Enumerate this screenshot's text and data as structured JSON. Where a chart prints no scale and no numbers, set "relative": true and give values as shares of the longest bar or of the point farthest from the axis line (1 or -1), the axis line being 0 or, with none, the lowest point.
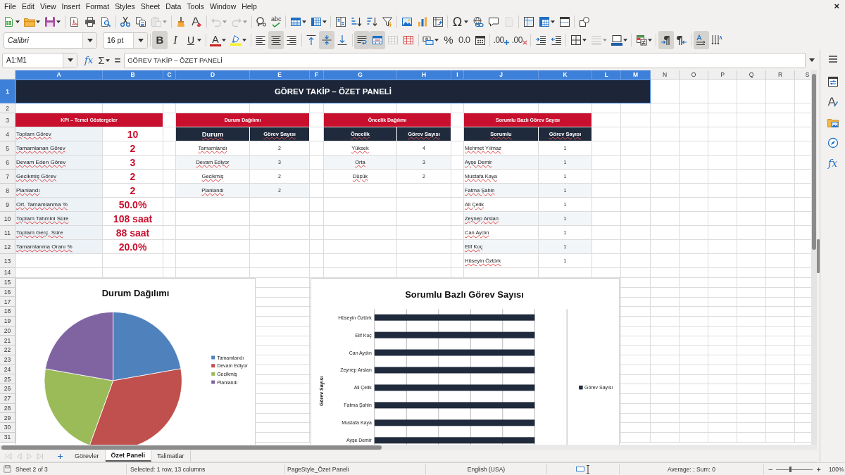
{
  "menu_bar": {
    "items": [
      "File",
      "Edit",
      "View",
      "Insert",
      "Format",
      "Styles",
      "Sheet",
      "Data",
      "Tools",
      "Window",
      "Help"
    ],
    "close": "×"
  },
  "standard_toolbar": {
    "groups": [
      [
        {
          "kind": "new",
          "dropdown": true,
          "disabled": false
        },
        {
          "kind": "open",
          "dropdown": true,
          "disabled": false
        },
        {
          "kind": "save",
          "dropdown": true,
          "disabled": false
        }
      ],
      [
        {
          "kind": "export_pdf",
          "dropdown": false,
          "disabled": false
        },
        {
          "kind": "print",
          "dropdown": false,
          "disabled": false
        },
        {
          "kind": "print_preview",
          "dropdown": false,
          "disabled": false
        }
      ],
      [
        {
          "kind": "cut",
          "dropdown": false,
          "disabled": false
        },
        {
          "kind": "copy",
          "dropdown": false,
          "disabled": false
        },
        {
          "kind": "paste",
          "dropdown": true,
          "disabled": true
        }
      ],
      [
        {
          "kind": "clone_formatting",
          "dropdown": false,
          "disabled": false
        },
        {
          "kind": "clear_formatting",
          "dropdown": false,
          "disabled": false
        }
      ],
      [
        {
          "kind": "undo",
          "dropdown": true,
          "disabled": true
        },
        {
          "kind": "redo",
          "dropdown": true,
          "disabled": true
        }
      ],
      [
        {
          "kind": "find_replace",
          "dropdown": false,
          "disabled": false
        },
        {
          "kind": "spelling",
          "label": "abc",
          "dropdown": false,
          "disabled": false
        }
      ],
      [
        {
          "kind": "rows",
          "dropdown": true,
          "disabled": false
        },
        {
          "kind": "columns",
          "dropdown": true,
          "disabled": false
        }
      ],
      [
        {
          "kind": "sort",
          "dropdown": false,
          "disabled": false
        },
        {
          "kind": "sort_ascending",
          "dropdown": false,
          "disabled": false
        },
        {
          "kind": "sort_descending",
          "dropdown": false,
          "disabled": false
        },
        {
          "kind": "autofilter",
          "dropdown": false,
          "disabled": false
        }
      ],
      [
        {
          "kind": "image",
          "dropdown": false,
          "disabled": false
        },
        {
          "kind": "chart",
          "dropdown": false,
          "disabled": false
        },
        {
          "kind": "pivot_table",
          "dropdown": false,
          "disabled": false
        }
      ],
      [
        {
          "kind": "special_character",
          "label": "Ω",
          "dropdown": true,
          "disabled": false
        },
        {
          "kind": "hyperlink",
          "dropdown": false,
          "disabled": false
        },
        {
          "kind": "comment",
          "dropdown": false,
          "disabled": false
        },
        {
          "kind": "header_footer",
          "dropdown": false,
          "disabled": true
        }
      ],
      [
        {
          "kind": "print_area",
          "dropdown": false,
          "disabled": false
        },
        {
          "kind": "freeze",
          "dropdown": true,
          "disabled": false
        },
        {
          "kind": "split_window",
          "dropdown": false,
          "disabled": false
        }
      ],
      [
        {
          "kind": "shapes",
          "dropdown": false,
          "disabled": false
        }
      ]
    ]
  },
  "formatting_toolbar": {
    "font_name": {
      "value": "Calibri"
    },
    "font_size": {
      "value": "16 pt"
    },
    "groups": [
      [
        {
          "kind": "bold",
          "label": "B",
          "on": true,
          "dropdown": false,
          "disabled": false
        },
        {
          "kind": "italic",
          "label": "I",
          "on": false,
          "dropdown": false,
          "disabled": false
        },
        {
          "kind": "underline",
          "label": "U",
          "on": false,
          "dropdown": true,
          "disabled": false
        }
      ],
      [
        {
          "kind": "font_color",
          "label": "A",
          "on": false,
          "dropdown": true,
          "disabled": false
        },
        {
          "kind": "highlight",
          "on": false,
          "dropdown": true,
          "disabled": false
        }
      ],
      [
        {
          "kind": "align_left",
          "on": false,
          "dropdown": false,
          "disabled": false
        },
        {
          "kind": "align_center",
          "on": true,
          "dropdown": false,
          "disabled": false
        },
        {
          "kind": "align_right",
          "on": false,
          "dropdown": false,
          "disabled": false
        }
      ],
      [
        {
          "kind": "align_top",
          "on": false,
          "dropdown": false,
          "disabled": false
        },
        {
          "kind": "align_middle",
          "on": true,
          "dropdown": false,
          "disabled": false
        },
        {
          "kind": "align_bottom",
          "on": false,
          "dropdown": false,
          "disabled": false
        }
      ],
      [
        {
          "kind": "wrap_text",
          "on": true,
          "dropdown": false,
          "disabled": false
        },
        {
          "kind": "merge_center",
          "on": true,
          "dropdown": false,
          "disabled": false
        },
        {
          "kind": "merge_cells",
          "on": false,
          "dropdown": false,
          "disabled": true
        },
        {
          "kind": "unmerge_cells",
          "on": false,
          "dropdown": false,
          "disabled": false
        }
      ],
      [
        {
          "kind": "currency",
          "on": false,
          "dropdown": true,
          "disabled": false
        },
        {
          "kind": "percent",
          "label": "%",
          "on": false,
          "dropdown": false,
          "disabled": false
        },
        {
          "kind": "number",
          "label": "0.0",
          "on": false,
          "dropdown": false,
          "disabled": false
        },
        {
          "kind": "date",
          "on": false,
          "dropdown": false,
          "disabled": false
        }
      ],
      [
        {
          "kind": "add_decimal",
          "label": ".00",
          "on": false,
          "dropdown": false,
          "disabled": false
        },
        {
          "kind": "delete_decimal",
          "label": ".00",
          "on": false,
          "dropdown": false,
          "disabled": false
        }
      ],
      [
        {
          "kind": "increase_indent",
          "on": false,
          "dropdown": false,
          "disabled": false
        },
        {
          "kind": "decrease_indent",
          "on": false,
          "dropdown": false,
          "disabled": false
        }
      ],
      [
        {
          "kind": "borders",
          "on": false,
          "dropdown": true,
          "disabled": false
        },
        {
          "kind": "border_style",
          "on": false,
          "dropdown": true,
          "disabled": true
        },
        {
          "kind": "border_color",
          "on": false,
          "dropdown": true,
          "disabled": false
        }
      ],
      [
        {
          "kind": "conditional",
          "on": false,
          "dropdown": true,
          "disabled": false
        }
      ],
      [
        {
          "kind": "left_to_right",
          "on": true,
          "dropdown": false,
          "disabled": false
        },
        {
          "kind": "right_to_left",
          "on": false,
          "dropdown": false,
          "disabled": false
        }
      ],
      [
        {
          "kind": "text_direction",
          "on": true,
          "dropdown": false,
          "disabled": false
        },
        {
          "kind": "vertical_text",
          "on": false,
          "dropdown": false,
          "disabled": false
        }
      ]
    ]
  },
  "name_box": {
    "value": "A1:M1"
  },
  "formula_bar": {
    "function_wizard": "fx",
    "sum": "Σ",
    "formula": "=",
    "value": "GÖREV TAKİP – ÖZET PANELİ"
  },
  "sheet": {
    "column_headers": [
      {
        "label": "A",
        "selected": true
      },
      {
        "label": "B",
        "selected": true
      },
      {
        "label": "C",
        "selected": true
      },
      {
        "label": "D",
        "selected": true
      },
      {
        "label": "E",
        "selected": true
      },
      {
        "label": "F",
        "selected": true
      },
      {
        "label": "G",
        "selected": true
      },
      {
        "label": "H",
        "selected": true
      },
      {
        "label": "I",
        "selected": true
      },
      {
        "label": "J",
        "selected": true
      },
      {
        "label": "K",
        "selected": true
      },
      {
        "label": "L",
        "selected": true
      },
      {
        "label": "M",
        "selected": true
      },
      {
        "label": "N",
        "selected": false
      },
      {
        "label": "O",
        "selected": false
      },
      {
        "label": "P",
        "selected": false
      },
      {
        "label": "Q",
        "selected": false
      },
      {
        "label": "R",
        "selected": false
      },
      {
        "label": "S",
        "selected": false
      }
    ],
    "row_headers": [
      {
        "label": "1",
        "selected": true
      },
      {
        "label": "2",
        "selected": false
      },
      {
        "label": "3",
        "selected": false
      },
      {
        "label": "4",
        "selected": false
      },
      {
        "label": "5",
        "selected": false
      },
      {
        "label": "6",
        "selected": false
      },
      {
        "label": "7",
        "selected": false
      },
      {
        "label": "8",
        "selected": false
      },
      {
        "label": "9",
        "selected": false
      },
      {
        "label": "10",
        "selected": false
      },
      {
        "label": "11",
        "selected": false
      },
      {
        "label": "12",
        "selected": false
      },
      {
        "label": "13",
        "selected": false
      },
      {
        "label": "14",
        "selected": false
      },
      {
        "label": "15",
        "selected": false
      },
      {
        "label": "16",
        "selected": false
      },
      {
        "label": "17",
        "selected": false
      },
      {
        "label": "18",
        "selected": false
      },
      {
        "label": "19",
        "selected": false
      },
      {
        "label": "20",
        "selected": false
      },
      {
        "label": "21",
        "selected": false
      },
      {
        "label": "22",
        "selected": false
      },
      {
        "label": "23",
        "selected": false
      },
      {
        "label": "24",
        "selected": false
      },
      {
        "label": "25",
        "selected": false
      },
      {
        "label": "26",
        "selected": false
      },
      {
        "label": "27",
        "selected": false
      },
      {
        "label": "28",
        "selected": false
      },
      {
        "label": "29",
        "selected": false
      },
      {
        "label": "30",
        "selected": false
      },
      {
        "label": "31",
        "selected": false
      }
    ],
    "title": "GÖREV TAKİP – ÖZET PANELİ",
    "kpi": {
      "title": "KPI – Temel Göstergeler",
      "rows": [
        {
          "label": "Toplam Görev",
          "value": "10"
        },
        {
          "label": "Tamamlanan Görev",
          "value": "2"
        },
        {
          "label": "Devam Eden Görev",
          "value": "3"
        },
        {
          "label": "Gecikmiş Görev",
          "value": "2"
        },
        {
          "label": "Planlandı",
          "value": "2"
        },
        {
          "label": "Ort. Tamamlanma %",
          "value": "50.0%"
        },
        {
          "label": "Toplam Tahmini Süre",
          "value": "108 saat"
        },
        {
          "label": "Toplam Gerç. Süre",
          "value": "88 saat"
        },
        {
          "label": "Tamamlanma Oranı %",
          "value": "20.0%"
        }
      ]
    },
    "tables": [
      {
        "title": "Durum Dağılımı",
        "columns": [
          "Durum",
          "Görev Sayısı"
        ],
        "rows": [
          [
            "Tamamlandı",
            "2"
          ],
          [
            "Devam Ediyor",
            "3"
          ],
          [
            "Gecikmiş",
            "2"
          ],
          [
            "Planlandı",
            "2"
          ]
        ]
      },
      {
        "title": "Öncelik Dağılımı",
        "columns": [
          "Öncelik",
          "Görev Sayısı"
        ],
        "rows": [
          [
            "Yüksek",
            "4"
          ],
          [
            "Orta",
            "3"
          ],
          [
            "Düşük",
            "2"
          ]
        ]
      },
      {
        "title": "Sorumlu Bazlı Görev Sayısı",
        "columns": [
          "Sorumlu",
          "Görev Sayısı"
        ],
        "rows": [
          [
            "Mehmet Yılmaz",
            "1"
          ],
          [
            "Ayşe Demir",
            "1"
          ],
          [
            "Mustafa Kaya",
            "1"
          ],
          [
            "Fatma Şahin",
            "1"
          ],
          [
            "Ali Çelik",
            "1"
          ],
          [
            "Zeynep Arslan",
            "1"
          ],
          [
            "Can Aydın",
            "1"
          ],
          [
            "Elif Koç",
            "1"
          ],
          [
            "Hüseyin Öztürk",
            "1"
          ]
        ]
      }
    ],
    "charts": [
      {
        "chart_data": {
          "type": "pie",
          "title": "Durum Dağılımı",
          "categories": [
            "Tamamlandı",
            "Devam Ediyor",
            "Gecikmiş",
            "Planlandı"
          ],
          "values": [
            22.22,
            33.33,
            22.22,
            22.23
          ],
          "legend": true
        },
        "slices": [
          {
            "color": "#4f81bd"
          },
          {
            "color": "#c0504d"
          },
          {
            "color": "#9bbb59"
          },
          {
            "color": "#8064a2"
          }
        ]
      },
      {
        "chart_data": {
          "type": "bar",
          "orientation": "horizontal",
          "title": "Sorumlu Bazlı Görev Sayısı",
          "ylabel": "Görev Sayısı",
          "categories": [
            "Hüseyin Öztürk",
            "Elif Koç",
            "Can Aydın",
            "Zeynep Arslan",
            "Ali Çelik",
            "Fatma Şahin",
            "Mustafa Kaya",
            "Ayşe Demir"
          ],
          "series": [
            {
              "name": "Görev Sayısı",
              "color": "#1f2a3c",
              "values": [
                1,
                1,
                1,
                1,
                1,
                1,
                1,
                1
              ]
            }
          ],
          "relative": true,
          "legend": true
        }
      }
    ]
  },
  "sheet_tabs": {
    "navigation_disabled": true,
    "tabs": [
      {
        "label": "Görevler",
        "selected": false
      },
      {
        "label": "Özet Paneli",
        "selected": true
      },
      {
        "label": "Talimatlar",
        "selected": false
      }
    ]
  },
  "sidebar": {
    "items": [
      {
        "kind": "properties"
      },
      {
        "kind": "styles"
      },
      {
        "kind": "gallery"
      },
      {
        "kind": "navigator"
      },
      {
        "kind": "functions",
        "label": "fx"
      }
    ]
  },
  "status_bar": {
    "sheet": "Sheet 2 of 3",
    "selection": "Selected: 1 row, 13 columns",
    "page_style": "PageStyle_Özet Paneli",
    "language": "English (USA)",
    "summary": "Average: ; Sum: 0",
    "zoom_out": "−",
    "zoom_in": "+",
    "zoom": {
      "level": 0.37,
      "reading": "100%"
    }
  }
}
